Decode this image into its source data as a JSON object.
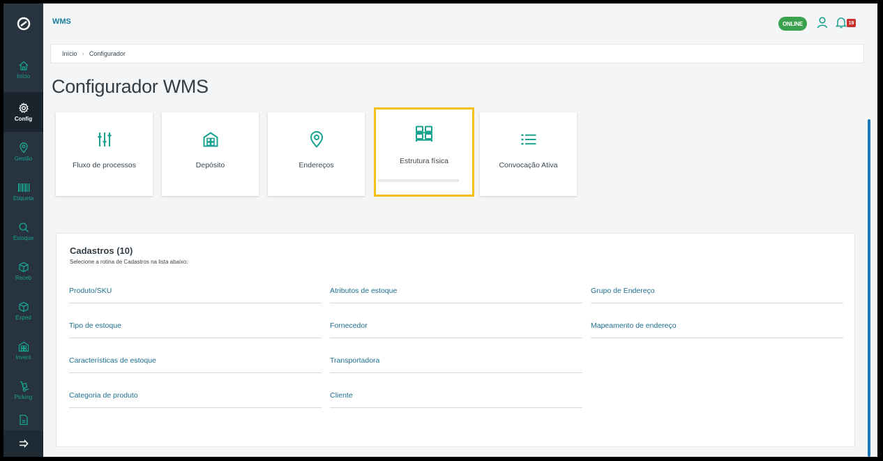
{
  "app": {
    "name": "WMS",
    "status": "ONLINE",
    "notifications": "19"
  },
  "sidebar": {
    "items": [
      {
        "label": "Início",
        "icon": "home-icon"
      },
      {
        "label": "Config",
        "icon": "gear-icon",
        "active": true
      },
      {
        "label": "Gestão",
        "icon": "location-pin-icon"
      },
      {
        "label": "Etiqueta",
        "icon": "barcode-icon"
      },
      {
        "label": "Estoque",
        "icon": "search-icon"
      },
      {
        "label": "Receb",
        "icon": "box-icon"
      },
      {
        "label": "Exped",
        "icon": "box-icon"
      },
      {
        "label": "Invent",
        "icon": "warehouse-icon"
      },
      {
        "label": "Picking",
        "icon": "hand-truck-icon"
      }
    ]
  },
  "breadcrumb": {
    "home": "Início",
    "current": "Configurador"
  },
  "page": {
    "title": "Configurador WMS"
  },
  "tiles": [
    {
      "label": "Fluxo de processos",
      "icon": "sliders-icon"
    },
    {
      "label": "Depósito",
      "icon": "warehouse-icon"
    },
    {
      "label": "Endereços",
      "icon": "location-pin-icon"
    },
    {
      "label": "Estrutura física",
      "icon": "shelves-icon",
      "selected": true
    },
    {
      "label": "Convocação Ativa",
      "icon": "list-icon"
    }
  ],
  "cadastros": {
    "title": "Cadastros (10)",
    "subtitle": "Selecione a rotina de Cadastros na lista abaixo:",
    "links": [
      "Produto/SKU",
      "Atributos de estoque",
      "Grupo de Endereço",
      "Tipo de estoque",
      "Fornecedor",
      "Mapeamento de endereço",
      "Características de estoque",
      "Transportadora",
      "Categoria de produto",
      "Cliente"
    ]
  },
  "colors": {
    "sidebar": "#27343f",
    "accent": "#19a28f",
    "highlight": "#f5c118",
    "online": "#3aa24f",
    "link": "#1e6e8e"
  }
}
